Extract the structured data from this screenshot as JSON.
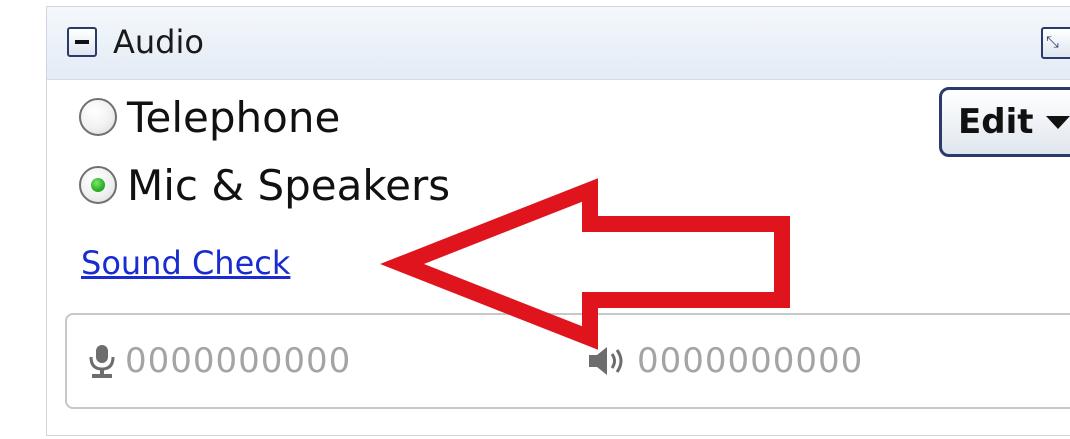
{
  "panel": {
    "title": "Audio"
  },
  "audio_options": [
    {
      "label": "Telephone",
      "selected": false
    },
    {
      "label": "Mic & Speakers",
      "selected": true
    }
  ],
  "edit_button": {
    "label": "Edit"
  },
  "sound_check_link": "Sound Check",
  "levels": {
    "mic_meter": "0000000000",
    "speaker_meter": "0000000000"
  },
  "colors": {
    "link": "#1a2bd0",
    "arrow": "#e0141c",
    "selected_radio": "#2fb52a",
    "header_bg": "#e3ebf5"
  },
  "icons": [
    "minus-icon",
    "popout-icon",
    "chevron-down-icon",
    "microphone-icon",
    "speaker-icon",
    "arrow-annotation"
  ]
}
